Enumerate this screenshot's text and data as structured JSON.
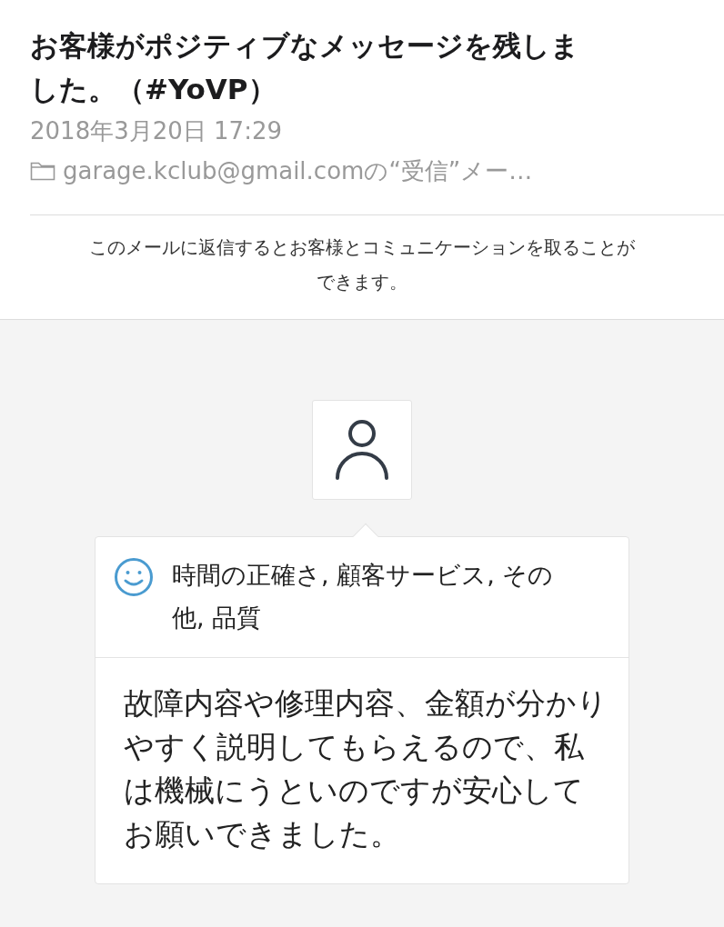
{
  "message": {
    "title": "お客様がポジティブなメッセージを残しました。（#YoVP）",
    "date": "2018年3月20日 17:29",
    "mailbox": "garage.kclub@gmail.comの“受信”メー…"
  },
  "notice": "このメールに返信するとお客様とコミュニケーションを取ることができます。",
  "review": {
    "categories": "時間の正確さ, 顧客サービス, その他, 品質",
    "comment": "故障内容や修理内容、金額が分かりやすく説明してもらえるので、私は機械にうといのですが安心してお願いできました。"
  }
}
